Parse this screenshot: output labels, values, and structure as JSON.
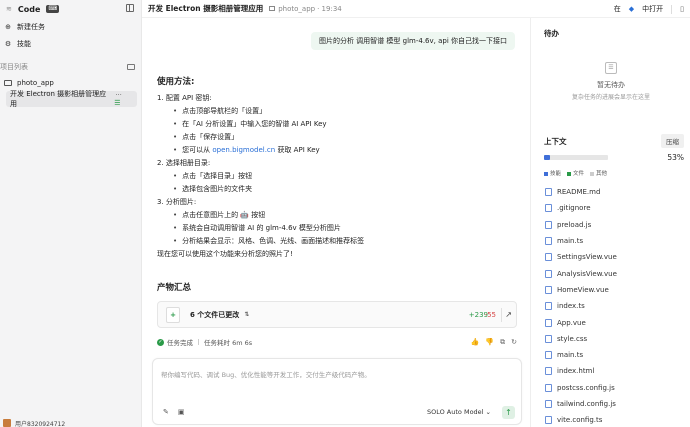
{
  "sidebar": {
    "brand": "Code",
    "code_badge": "⌨",
    "new_task": "新建任务",
    "skills": "技能",
    "project_list_label": "项目列表",
    "project_name": "photo_app",
    "task_title": "开发 Electron 摄影相册管理应用",
    "user_name": "用户8320924712"
  },
  "header": {
    "title": "开发 Electron 摄影相册管理应用",
    "project": "photo_app",
    "time": "· 19:34",
    "open_in_label": "在",
    "open_label": "中打开"
  },
  "chat": {
    "user_message": "图片的分析 调用智谱 模型 glm-4.6v, api 你自己找一下接口",
    "heading": "使用方法:",
    "steps": [
      {
        "title": "1. 配置 API 密钥:",
        "items": [
          "点击顶部导航栏的「设置」",
          "在「AI 分析设置」中输入您的智谱 AI API Key",
          "点击「保存设置」",
          "您可以从 open.bigmodel.cn 获取 API Key"
        ]
      },
      {
        "title": "2. 选择相册目录:",
        "items": [
          "点击「选择目录」按钮",
          "选择包含图片的文件夹"
        ]
      },
      {
        "title": "3. 分析图片:",
        "items": [
          "点击任意图片上的 🤖 按钮",
          "系统会自动调用智谱 AI 的 glm-4.6v 模型分析图片",
          "分析结果会显示：风格、色调、光线、画面描述和推荐标签"
        ]
      }
    ],
    "link_text": "open.bigmodel.cn",
    "link_prefix": "您可以从",
    "link_suffix": "获取 API Key",
    "closing": "现在您可以使用这个功能来分析您的照片了!",
    "summary_title": "产物汇总",
    "summary_files": "6 个文件已更改",
    "additions": "+239",
    "deletions": "-55",
    "status_done": "任务完成",
    "status_time": "任务耗时 6m 6s",
    "composer_placeholder": "帮你编写代码、调试 Bug、优化性能等开发工作，交付生产级代码产物。",
    "model": "SOLO Auto Model"
  },
  "right_panel": {
    "todo_title": "待办",
    "todo_empty": "暂无待办",
    "todo_empty_sub": "复杂任务的进展会显示在这里",
    "context_title": "上下文",
    "compress": "压缩",
    "usage_percent": "53%",
    "usage_fill": 0.1,
    "legend": [
      "技能",
      "文件",
      "其他"
    ],
    "legend_colors": [
      "#3f6fd8",
      "#2a9a48",
      "#cccccc"
    ],
    "files": [
      "README.md",
      ".gitignore",
      "preload.js",
      "main.ts",
      "SettingsView.vue",
      "AnalysisView.vue",
      "HomeView.vue",
      "index.ts",
      "App.vue",
      "style.css",
      "main.ts",
      "index.html",
      "postcss.config.js",
      "tailwind.config.js",
      "vite.config.ts"
    ]
  }
}
